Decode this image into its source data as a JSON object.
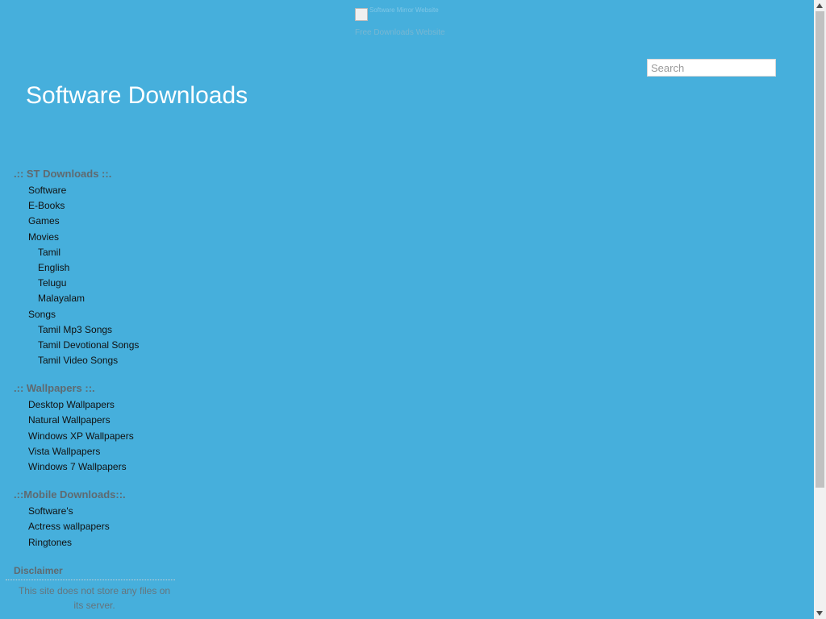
{
  "header": {
    "banner_alt": "Software Mirror Website",
    "banner_link": "Free Downloads Website",
    "search_placeholder": "Search",
    "site_title": "Software Downloads"
  },
  "sidebar": {
    "sections": [
      {
        "title": ".:: ST Downloads ::.",
        "items": [
          {
            "label": "Software",
            "level": 1
          },
          {
            "label": "E-Books",
            "level": 1
          },
          {
            "label": "Games",
            "level": 1
          },
          {
            "label": "Movies",
            "level": 1
          },
          {
            "label": "Tamil",
            "level": 2
          },
          {
            "label": "English",
            "level": 2
          },
          {
            "label": "Telugu",
            "level": 2
          },
          {
            "label": "Malayalam",
            "level": 2
          },
          {
            "label": "Songs",
            "level": 1
          },
          {
            "label": "Tamil Mp3 Songs",
            "level": 2
          },
          {
            "label": "Tamil Devotional Songs",
            "level": 2
          },
          {
            "label": "Tamil Video Songs",
            "level": 2
          }
        ]
      },
      {
        "title": ".:: Wallpapers ::.",
        "items": [
          {
            "label": "Desktop Wallpapers",
            "level": 1
          },
          {
            "label": "Natural Wallpapers",
            "level": 1
          },
          {
            "label": "Windows XP Wallpapers",
            "level": 1
          },
          {
            "label": "Vista Wallpapers",
            "level": 1
          },
          {
            "label": "Windows 7 Wallpapers",
            "level": 1
          }
        ]
      },
      {
        "title": ".::Mobile Downloads::.",
        "items": [
          {
            "label": "Software's",
            "level": 1
          },
          {
            "label": "Actress wallpapers",
            "level": 1
          },
          {
            "label": "Ringtones",
            "level": 1
          }
        ]
      }
    ],
    "disclaimer": {
      "title": "Disclaimer",
      "text": "This site does not store any files on its server."
    }
  },
  "colors": {
    "background": "#46afdc",
    "title_text": "#ffffff",
    "section_title": "#5f6a70"
  },
  "icons": {
    "broken_image": "broken-image-icon",
    "scroll_up": "arrow-up-icon",
    "scroll_down": "arrow-down-icon"
  },
  "scroll": {
    "position_fraction": 0.0
  }
}
